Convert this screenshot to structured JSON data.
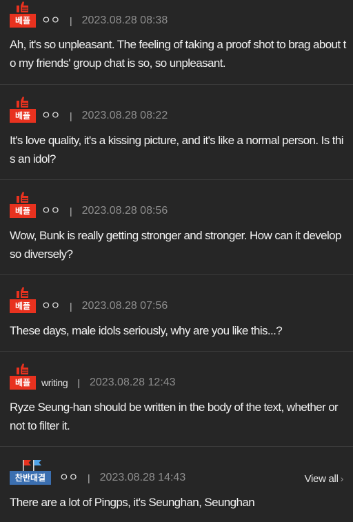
{
  "comments": [
    {
      "badge": "베플",
      "badge_type": "best",
      "author": "ㅇㅇ",
      "separator": "|",
      "timestamp": "2023.08.28 08:38",
      "text": "Ah, it's so unpleasant. The feeling of taking a proof shot to brag about to my friends' group chat is so, so unpleasant."
    },
    {
      "badge": "베플",
      "badge_type": "best",
      "author": "ㅇㅇ",
      "separator": "|",
      "timestamp": "2023.08.28 08:22",
      "text": "It's love quality, it's a kissing picture, and it's like a normal person. Is this an idol?"
    },
    {
      "badge": "베플",
      "badge_type": "best",
      "author": "ㅇㅇ",
      "separator": "|",
      "timestamp": "2023.08.28 08:56",
      "text": "Wow, Bunk is really getting stronger and stronger. How can it develop so diversely?"
    },
    {
      "badge": "베플",
      "badge_type": "best",
      "author": "ㅇㅇ",
      "separator": "|",
      "timestamp": "2023.08.28 07:56",
      "text": "These days, male idols seriously, why are you like this...?"
    },
    {
      "badge": "베플",
      "badge_type": "best",
      "author": "writing",
      "separator": "|",
      "timestamp": "2023.08.28 12:43",
      "text": "Ryze Seung-han should be written in the body of the text, whether or not to filter it."
    },
    {
      "badge": "찬반대결",
      "badge_type": "versus",
      "author": "ㅇㅇ",
      "separator": "|",
      "timestamp": "2023.08.28 14:43",
      "view_all": "View all",
      "text": "There are a lot of Pingps, it's Seunghan, Seunghan"
    }
  ],
  "colors": {
    "background": "#262626",
    "best_badge": "#e8321f",
    "versus_badge": "#3b6fb0",
    "text": "#f2f2f2",
    "timestamp": "#8e8e8e",
    "divider": "#3a3a3a"
  },
  "icons": {
    "best_badge_icon": "thumbs-up-icon",
    "versus_badge_icon": "flags-icon",
    "view_all_icon": "chevron-right-icon"
  }
}
